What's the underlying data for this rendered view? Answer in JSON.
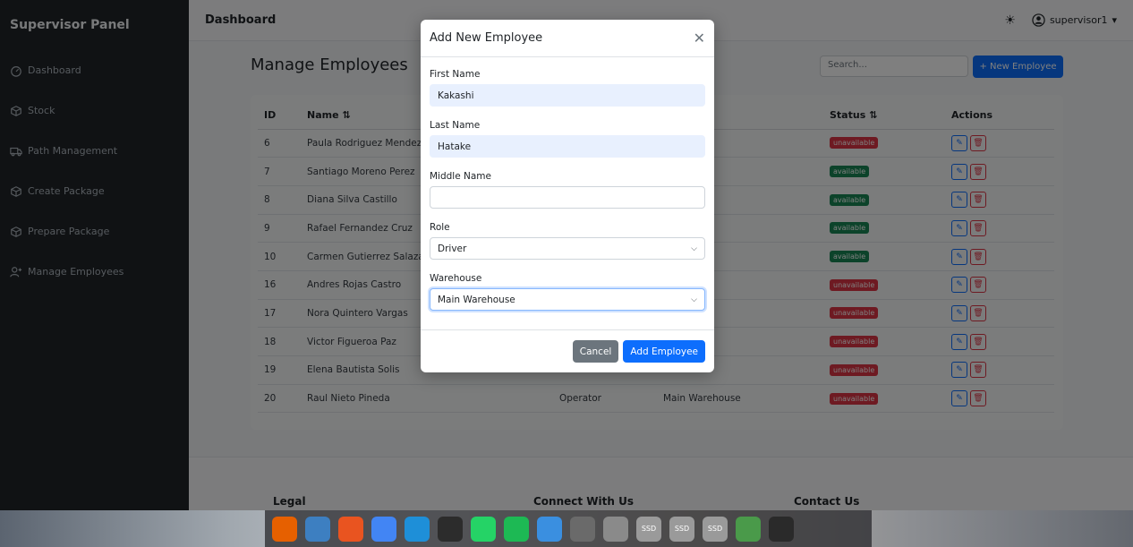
{
  "sidebar": {
    "brand": "Supervisor Panel",
    "items": [
      {
        "label": "Dashboard",
        "icon": "gauge-icon"
      },
      {
        "label": "Stock",
        "icon": "box-icon"
      },
      {
        "label": "Path Management",
        "icon": "truck-icon"
      },
      {
        "label": "Create Package",
        "icon": "box-icon"
      },
      {
        "label": "Prepare Package",
        "icon": "box-icon"
      },
      {
        "label": "Manage Employees",
        "icon": "person-add-icon"
      }
    ]
  },
  "header": {
    "title": "Dashboard",
    "theme_icon": "☀",
    "user": "supervisor1",
    "user_caret": "▾"
  },
  "page": {
    "title": "Manage Employees",
    "search_placeholder": "Search...",
    "new_button": "+ New Employee"
  },
  "table": {
    "headers": {
      "id": "ID",
      "name": "Name ⇅",
      "col3": "",
      "wh": "⇅",
      "status": "Status ⇅",
      "actions": "Actions"
    },
    "rows": [
      {
        "id": "6",
        "name": "Paula Rodriguez Mendez",
        "role": "",
        "wh": "use",
        "status": "unavailable"
      },
      {
        "id": "7",
        "name": "Santiago Moreno Perez",
        "role": "",
        "wh": "use",
        "status": "available"
      },
      {
        "id": "8",
        "name": "Diana Silva Castillo",
        "role": "",
        "wh": "use",
        "status": "available"
      },
      {
        "id": "9",
        "name": "Rafael Fernandez Cruz",
        "role": "",
        "wh": "use",
        "status": "available"
      },
      {
        "id": "10",
        "name": "Carmen Gutierrez Salazar",
        "role": "",
        "wh": "use",
        "status": "available"
      },
      {
        "id": "16",
        "name": "Andres Rojas Castro",
        "role": "",
        "wh": "use",
        "status": "unavailable"
      },
      {
        "id": "17",
        "name": "Nora Quintero Vargas",
        "role": "",
        "wh": "use",
        "status": "unavailable"
      },
      {
        "id": "18",
        "name": "Victor Figueroa Paz",
        "role": "",
        "wh": "use",
        "status": "unavailable"
      },
      {
        "id": "19",
        "name": "Elena Bautista Solis",
        "role": "",
        "wh": "use",
        "status": "unavailable"
      },
      {
        "id": "20",
        "name": "Raul Nieto Pineda",
        "role": "Operator",
        "wh": "Main Warehouse",
        "status": "unavailable"
      }
    ]
  },
  "footer": {
    "legal": "Legal",
    "connect": "Connect With Us",
    "contact": "Contact Us"
  },
  "modal": {
    "title": "Add New Employee",
    "close": "✕",
    "first_name_label": "First Name",
    "first_name_value": "Kakashi",
    "last_name_label": "Last Name",
    "last_name_value": "Hatake",
    "middle_name_label": "Middle Name",
    "middle_name_value": "",
    "role_label": "Role",
    "role_value": "Driver",
    "warehouse_label": "Warehouse",
    "warehouse_value": "Main Warehouse",
    "cancel": "Cancel",
    "submit": "Add Employee"
  },
  "dock": {
    "apps": [
      {
        "name": "firefox-icon",
        "color": "#e66000"
      },
      {
        "name": "files-icon",
        "color": "#3d7fc1"
      },
      {
        "name": "app-store-icon",
        "color": "#e95420"
      },
      {
        "name": "chrome-icon",
        "color": "#4285f4"
      },
      {
        "name": "vscode-icon",
        "color": "#1e8fd8"
      },
      {
        "name": "terminal-icon",
        "color": "#2c2c2c"
      },
      {
        "name": "whatsapp-icon",
        "color": "#25d366"
      },
      {
        "name": "spotify-icon",
        "color": "#1db954"
      },
      {
        "name": "help-icon",
        "color": "#3a8fe0"
      },
      {
        "name": "settings-icon",
        "color": "#6a6a6a"
      },
      {
        "name": "screenshot-icon",
        "color": "#8a8a8a"
      },
      {
        "name": "drive-ssd-icon",
        "color": "#9a9a9a",
        "text": "SSD"
      },
      {
        "name": "drive-ssd-icon",
        "color": "#9a9a9a",
        "text": "SSD"
      },
      {
        "name": "drive-ssd-icon",
        "color": "#9a9a9a",
        "text": "SSD"
      },
      {
        "name": "trash-icon",
        "color": "#4a9a4a"
      },
      {
        "name": "ubuntu-icon",
        "color": "#2a2a2a"
      }
    ]
  }
}
